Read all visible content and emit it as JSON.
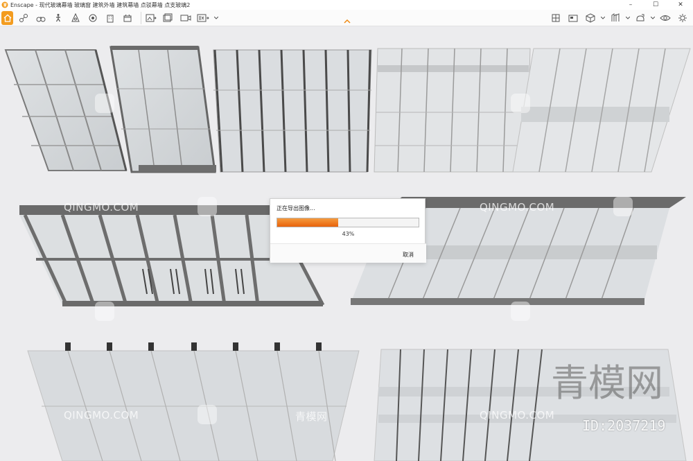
{
  "window": {
    "title": "Enscape - 现代玻璃幕墙 玻璃窗 建筑外墙 建筑幕墙 点驳幕墙 点支玻璃2",
    "minimize": "–",
    "maximize": "☐",
    "close": "✕"
  },
  "toolbar": {
    "left_icons": [
      "home-icon",
      "connect-icon",
      "binoculars-icon",
      "walk-icon",
      "compass-icon",
      "sun-icon",
      "building-icon",
      "panorama-icon",
      "export-image-icon",
      "batch-export-icon",
      "video-export-icon",
      "exe-export-icon"
    ],
    "right_icons": [
      "material-icon",
      "screenshot-icon",
      "box-icon",
      "asset-icon",
      "upload-icon",
      "vr-icon",
      "settings-icon"
    ]
  },
  "watermarks": {
    "site": "QINGMO.COM",
    "site_cn": "青模网",
    "big": "青模网",
    "id": "ID:2037219"
  },
  "dialog": {
    "title": "正在导出图像...",
    "progress_percent": 43,
    "progress_text": "43%",
    "cancel_label": "取消"
  },
  "colors": {
    "accent": "#f39c1f",
    "progress": "#e8620c"
  }
}
